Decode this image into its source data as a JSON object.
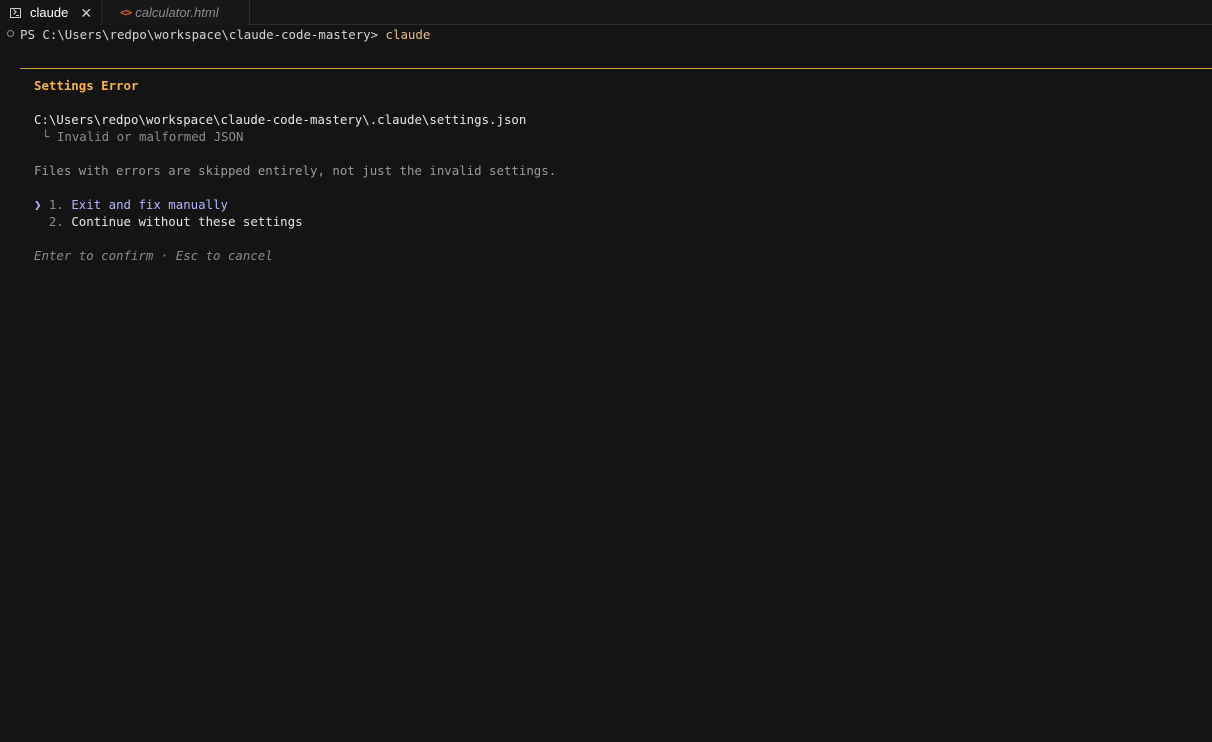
{
  "tabs": [
    {
      "label": "claude",
      "icon": "terminal-icon",
      "active": true
    },
    {
      "label": "calculator.html",
      "icon": "code-icon",
      "active": false
    }
  ],
  "terminal": {
    "prompt": "PS C:\\Users\\redpo\\workspace\\claude-code-mastery>",
    "command": "claude"
  },
  "dialog": {
    "title": "Settings Error",
    "file_path": "C:\\Users\\redpo\\workspace\\claude-code-mastery\\.claude\\settings.json",
    "file_error": "Invalid or malformed JSON",
    "info": "Files with errors are skipped entirely, not just the invalid settings.",
    "options": [
      {
        "number": "1.",
        "label": "Exit and fix manually",
        "selected": true
      },
      {
        "number": "2.",
        "label": "Continue without these settings",
        "selected": false
      }
    ],
    "hint": "Enter to confirm · Esc to cancel"
  },
  "colors": {
    "background": "#141414",
    "accent_warning": "#f5b44a",
    "selected": "#b7b6ff",
    "command": "#e5c07b"
  }
}
